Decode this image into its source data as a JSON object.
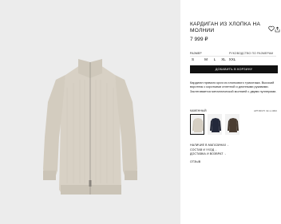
{
  "product": {
    "title": "КАРДИГАН ИЗ ХЛОПКА НА МОЛНИИ",
    "price": "7 999 ₽",
    "description": "Кардиган прямого кроя из хлопкового трикотажа. Высокий воротник с короткими отлетной и длинными рукавами. Застегивается металлической молнией с двумя пуллерами."
  },
  "sizing": {
    "caption": "РАЗМЕР",
    "guide_label": "РУКОВОДСТВО ПО РАЗМЕРАМ",
    "options": [
      "S",
      "M",
      "L",
      "XL",
      "XXL"
    ]
  },
  "actions": {
    "add_to_bag": "ДОБАВИТЬ В КОРЗИНУ"
  },
  "color": {
    "label": "КАМЕННЫЙ",
    "article": "АРТИКУЛ: 32-1-1993",
    "swatches": [
      {
        "name": "stone",
        "hex": "#d6cfc3",
        "selected": true
      },
      {
        "name": "navy",
        "hex": "#23283a",
        "selected": false
      },
      {
        "name": "brown",
        "hex": "#4a3d32",
        "selected": false
      }
    ]
  },
  "links": {
    "availability": "НАЛИЧИЕ В МАГАЗИНАХ",
    "composition": "СОСТАВ И УХОД",
    "delivery": "ДОСТАВКА И ВОЗВРАТ",
    "share": "ОТЗЫВ"
  },
  "icons": {
    "wishlist": "heart-outline-icon",
    "share": "share-icon",
    "chevron": "chevron-right-icon"
  },
  "colors": {
    "image_background": "#ececec",
    "garment": "#d8d1c5",
    "button": "#111111"
  }
}
